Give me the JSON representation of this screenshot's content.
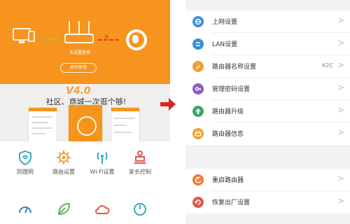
{
  "left": {
    "router_label": "未设置管理",
    "close_wifi_button": "关闭穿墙",
    "promo": {
      "version": "V4.0",
      "text": "社区、商城一次逛个够!"
    },
    "grid_items": [
      {
        "label": "防蹭网",
        "icon": "shield-wifi-icon",
        "color": "#3aa8c1"
      },
      {
        "label": "路由设置",
        "icon": "gear-icon",
        "color": "#f0a030"
      },
      {
        "label": "Wi-Fi设置",
        "icon": "wifi-antenna-icon",
        "color": "#3aa8c1"
      },
      {
        "label": "家长控制",
        "icon": "parental-control-icon",
        "color": "#e2554a"
      },
      {
        "label": "",
        "icon": "speedometer-icon",
        "color": "#3a7fc1"
      },
      {
        "label": "",
        "icon": "leaf-icon",
        "color": "#5cb85c"
      },
      {
        "label": "",
        "icon": "cloud-icon",
        "color": "#e2554a"
      },
      {
        "label": "",
        "icon": "gauge-icon",
        "color": "#3aa8c1"
      }
    ]
  },
  "right": {
    "groups": [
      [
        {
          "label": "上网设置",
          "icon": "globe-icon",
          "color": "#3a8fd9",
          "value": ""
        },
        {
          "label": "LAN设置",
          "icon": "lan-icon",
          "color": "#3a8fd9",
          "value": ""
        },
        {
          "label": "路由器名称设置",
          "icon": "pencil-icon",
          "color": "#f0a030",
          "value": "K2C"
        },
        {
          "label": "管理密码设置",
          "icon": "key-icon",
          "color": "#8e5ac8",
          "value": ""
        },
        {
          "label": "路由器升级",
          "icon": "upgrade-arrow-icon",
          "color": "#3aa864",
          "value": ""
        },
        {
          "label": "路由器信息",
          "icon": "router-info-icon",
          "color": "#f0a030",
          "value": ""
        }
      ],
      [
        {
          "label": "重启路由器",
          "icon": "restart-icon",
          "color": "#f07830",
          "value": ""
        },
        {
          "label": "恢复出厂设置",
          "icon": "factory-reset-icon",
          "color": "#e2554a",
          "value": ""
        }
      ]
    ],
    "chevron": ">"
  },
  "colors": {
    "brand_orange": "#f7941d",
    "arrow_red": "#e02020",
    "background_gray": "#f2f2f2"
  }
}
